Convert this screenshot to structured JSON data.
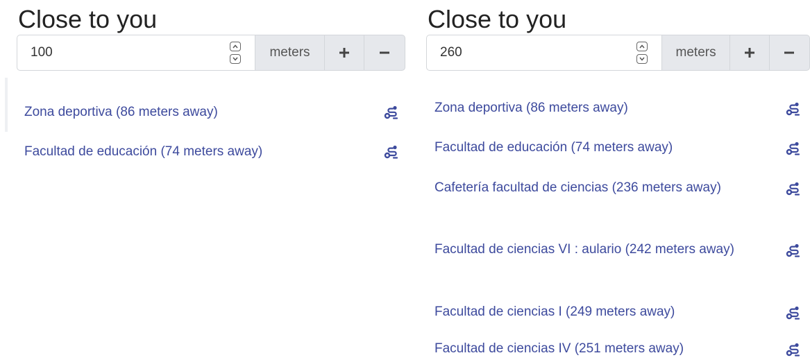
{
  "colors": {
    "link": "#3d4a9d",
    "addon_bg": "#e6e8ec",
    "border": "#d3d6da"
  },
  "panels": {
    "left": {
      "title": "Close to you",
      "distance_value": "100",
      "units_label": "meters",
      "plus_label": "+",
      "minus_label": "−",
      "results": [
        {
          "label": "Zona deportiva (86 meters away)",
          "icon": "route-icon"
        },
        {
          "label": "Facultad de educación (74 meters away)",
          "icon": "route-icon"
        }
      ]
    },
    "right": {
      "title": "Close to you",
      "distance_value": "260",
      "units_label": "meters",
      "plus_label": "+",
      "minus_label": "−",
      "results": [
        {
          "label": "Zona deportiva (86 meters away)",
          "icon": "route-icon"
        },
        {
          "label": "Facultad de educación (74 meters away)",
          "icon": "route-icon"
        },
        {
          "label": "Cafetería facultad de ciencias (236 meters away)",
          "icon": "route-icon"
        },
        {
          "label": "Facultad de ciencias VI : aulario (242 meters away)",
          "icon": "route-icon"
        },
        {
          "label": "Facultad de ciencias I (249 meters away)",
          "icon": "route-icon"
        },
        {
          "label": "Facultad de ciencias IV (251 meters away)",
          "icon": "route-icon"
        }
      ]
    }
  }
}
